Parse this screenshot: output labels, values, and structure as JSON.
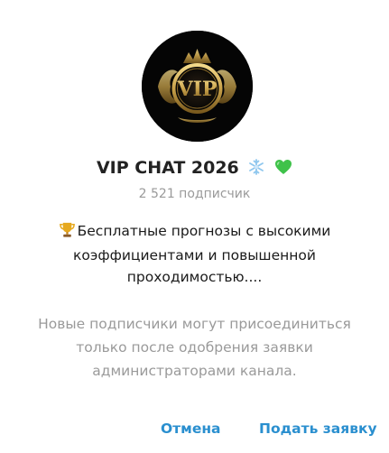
{
  "channel": {
    "title": "VIP CHAT 2026",
    "title_emojis": [
      "snowflake-icon",
      "green-heart-icon"
    ],
    "avatar_text": "VIP",
    "subscribers": "2 521 подписчик",
    "description": "Бесплатные прогнозы с высокими коэффициентами и повышенной проходимостью....",
    "description_emoji": "trophy-icon"
  },
  "notice": "Новые подписчики могут присоединиться только после одобрения заявки администраторами канала.",
  "actions": {
    "cancel_label": "Отмена",
    "submit_label": "Подать заявку"
  },
  "colors": {
    "accent": "#2a8fcf",
    "muted_text": "#9a9a9a",
    "title_text": "#222222",
    "avatar_bg": "#050505",
    "avatar_gold": "#c9a24a"
  }
}
